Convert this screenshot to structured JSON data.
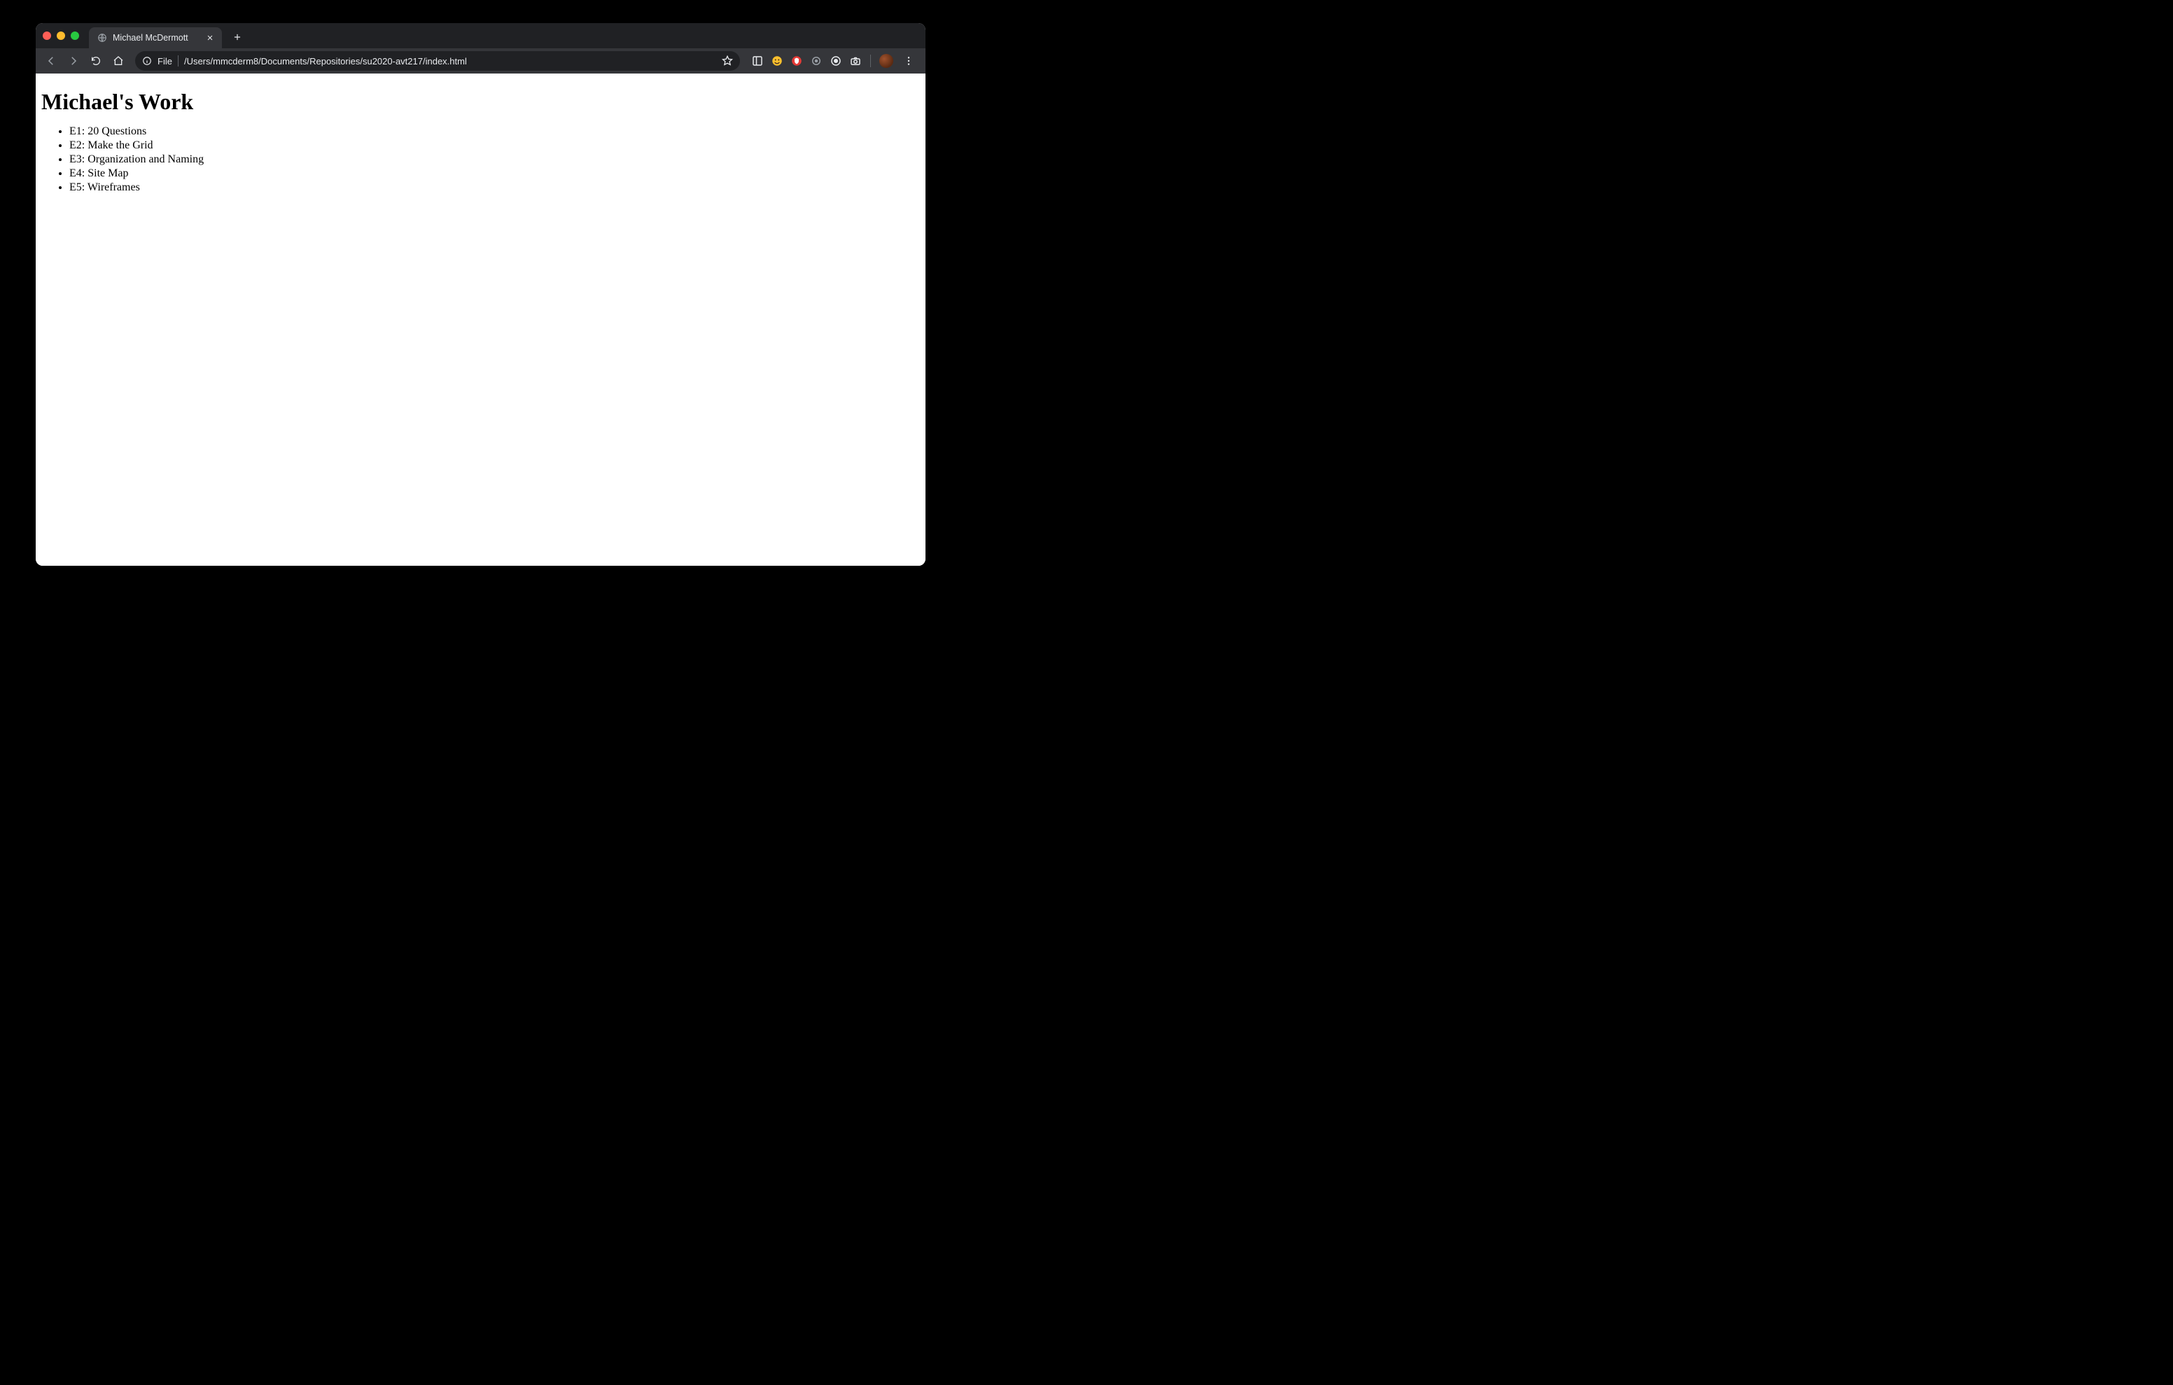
{
  "tab": {
    "title": "Michael McDermott"
  },
  "address": {
    "scheme": "File",
    "path": "/Users/mmcderm8/Documents/Repositories/su2020-avt217/index.html"
  },
  "page": {
    "heading": "Michael's Work",
    "items": [
      "E1: 20 Questions",
      "E2: Make the Grid",
      "E3: Organization and Naming",
      "E4: Site Map",
      "E5: Wireframes"
    ]
  },
  "extensions": [
    {
      "name": "panel-icon"
    },
    {
      "name": "emoji-icon"
    },
    {
      "name": "shield-icon"
    },
    {
      "name": "dot-icon"
    },
    {
      "name": "record-icon"
    },
    {
      "name": "camera-icon"
    }
  ]
}
